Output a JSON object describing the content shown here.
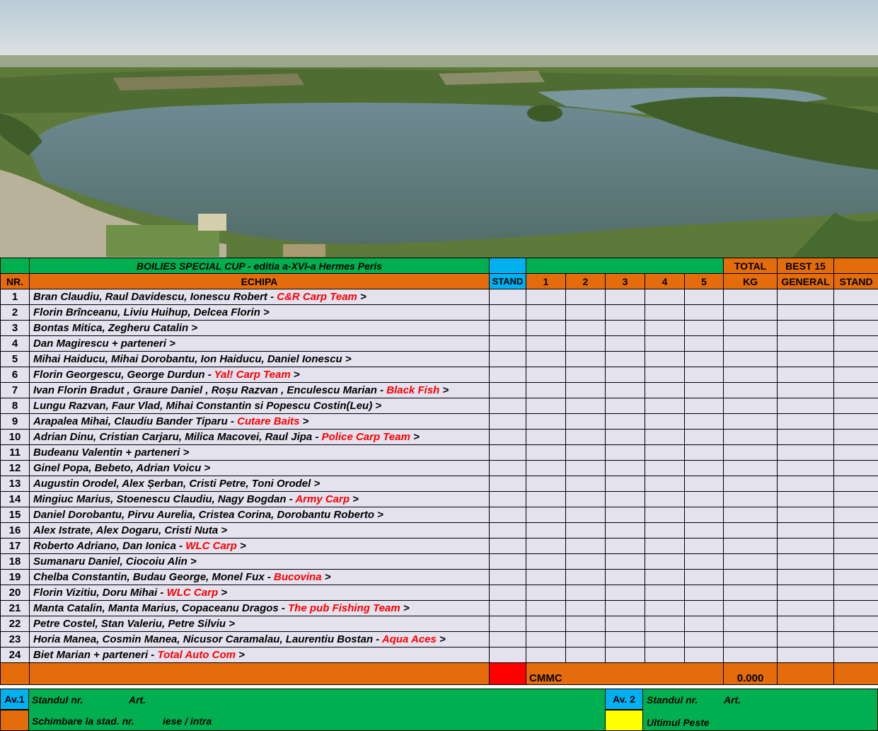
{
  "header": {
    "title": "BOILIES SPECIAL CUP - editia a-XVI-a Hermes Peris",
    "total_top": "TOTAL",
    "best_top": "BEST 15",
    "col_nr": "NR.",
    "col_echipa": "ECHIPA",
    "col_stand": "STAND",
    "col_1": "1",
    "col_2": "2",
    "col_3": "3",
    "col_4": "4",
    "col_5": "5",
    "col_kg": "KG",
    "col_general": "GENERAL",
    "col_stand2": "STAND"
  },
  "teams": [
    {
      "nr": "1",
      "names": "Bran Claudiu, Raul Davidescu, Ionescu Robert - ",
      "club": "C&R Carp Team",
      "tail": " >"
    },
    {
      "nr": "2",
      "names": "Florin Brînceanu, Liviu Huihup, Delcea Florin  >",
      "club": "",
      "tail": ""
    },
    {
      "nr": "3",
      "names": "Bontas Mitica,  Zegheru  Catalin  >",
      "club": "",
      "tail": ""
    },
    {
      "nr": "4",
      "names": "Dan Magirescu  + parteneri  >",
      "club": "",
      "tail": ""
    },
    {
      "nr": "5",
      "names": "Mihai Haiducu, Mihai Dorobantu, Ion Haiducu, Daniel Ionescu  >",
      "club": "",
      "tail": ""
    },
    {
      "nr": "6",
      "names": "Florin Georgescu, George Durdun - ",
      "club": "Yal! Carp Team",
      "tail": "  >"
    },
    {
      "nr": "7",
      "names": "Ivan Florin Bradut , Graure Daniel , Roșu Razvan , Enculescu Marian - ",
      "club": "Black Fish",
      "tail": "  >"
    },
    {
      "nr": "8",
      "names": "Lungu Razvan, Faur Vlad, Mihai Constantin si Popescu Costin(Leu)  >",
      "club": "",
      "tail": ""
    },
    {
      "nr": "9",
      "names": "Arapalea Mihai, Claudiu Bander Tiparu - ",
      "club": "Cutare Baits",
      "tail": "  >"
    },
    {
      "nr": "10",
      "names": "Adrian Dinu, Cristian Carjaru, Milica Macovei, Raul Jipa - ",
      "club": "Police Carp Team",
      "tail": "  >"
    },
    {
      "nr": "11",
      "names": "Budeanu Valentin + parteneri  >",
      "club": "",
      "tail": ""
    },
    {
      "nr": "12",
      "names": "Ginel Popa, Bebeto, Adrian Voicu  >",
      "club": "",
      "tail": ""
    },
    {
      "nr": "13",
      "names": "Augustin Orodel, Alex Șerban, Cristi Petre, Toni Orodel  >",
      "club": "",
      "tail": ""
    },
    {
      "nr": "14",
      "names": "Mingiuc Marius, Stoenescu Claudiu, Nagy Bogdan - ",
      "club": "Army Carp",
      "tail": "  >"
    },
    {
      "nr": "15",
      "names": "Daniel Dorobantu, Pirvu Aurelia, Cristea Corina, Dorobantu Roberto  >",
      "club": "",
      "tail": ""
    },
    {
      "nr": "16",
      "names": "Alex Istrate, Alex Dogaru, Cristi Nuta  >",
      "club": "",
      "tail": ""
    },
    {
      "nr": "17",
      "names": "Roberto Adriano, Dan Ionica - ",
      "club": "WLC Carp",
      "tail": "  >"
    },
    {
      "nr": "18",
      "names": "Sumanaru Daniel, Ciocoiu Alin  >",
      "club": "",
      "tail": ""
    },
    {
      "nr": "19",
      "names": "Chelba Constantin,  Budau George, Monel Fux - ",
      "club": "Bucovina",
      "tail": "  >"
    },
    {
      "nr": "20",
      "names": "Florin Vizitiu, Doru Mihai  - ",
      "club": "WLC Carp",
      "tail": "  >"
    },
    {
      "nr": "21",
      "names": "Manta Catalin, Manta Marius, Copaceanu Dragos - ",
      "club": "The pub Fishing Team",
      "tail": "  >"
    },
    {
      "nr": "22",
      "names": "Petre Costel, Stan Valeriu, Petre Silviu  >",
      "club": "",
      "tail": ""
    },
    {
      "nr": "23",
      "names": "Horia Manea, Cosmin Manea, Nicusor Caramalau, Laurentiu Bostan - ",
      "club": "Aqua Aces",
      "tail": " >"
    },
    {
      "nr": "24",
      "names": "Biet Marian + parteneri  - ",
      "club": "Total Auto Com",
      "tail": " >"
    }
  ],
  "totals": {
    "label": "CMMC",
    "value": "0.000"
  },
  "footer": {
    "av1": "Av.1",
    "standul1": "Standul nr.",
    "art1": "Art.",
    "schimbare": "Schimbare la stad.  nr.",
    "iese": "iese / intra",
    "av2": "Av. 2",
    "standul2": "Standul  nr.",
    "art2": "Art.",
    "ultimul": "Ultimul Peste"
  },
  "colors": {
    "green": "#00b050",
    "orange": "#e46c0a",
    "blue": "#00b0f0",
    "red": "#ff0000",
    "yellow": "#ffff00",
    "cell": "#e4e2ee"
  }
}
